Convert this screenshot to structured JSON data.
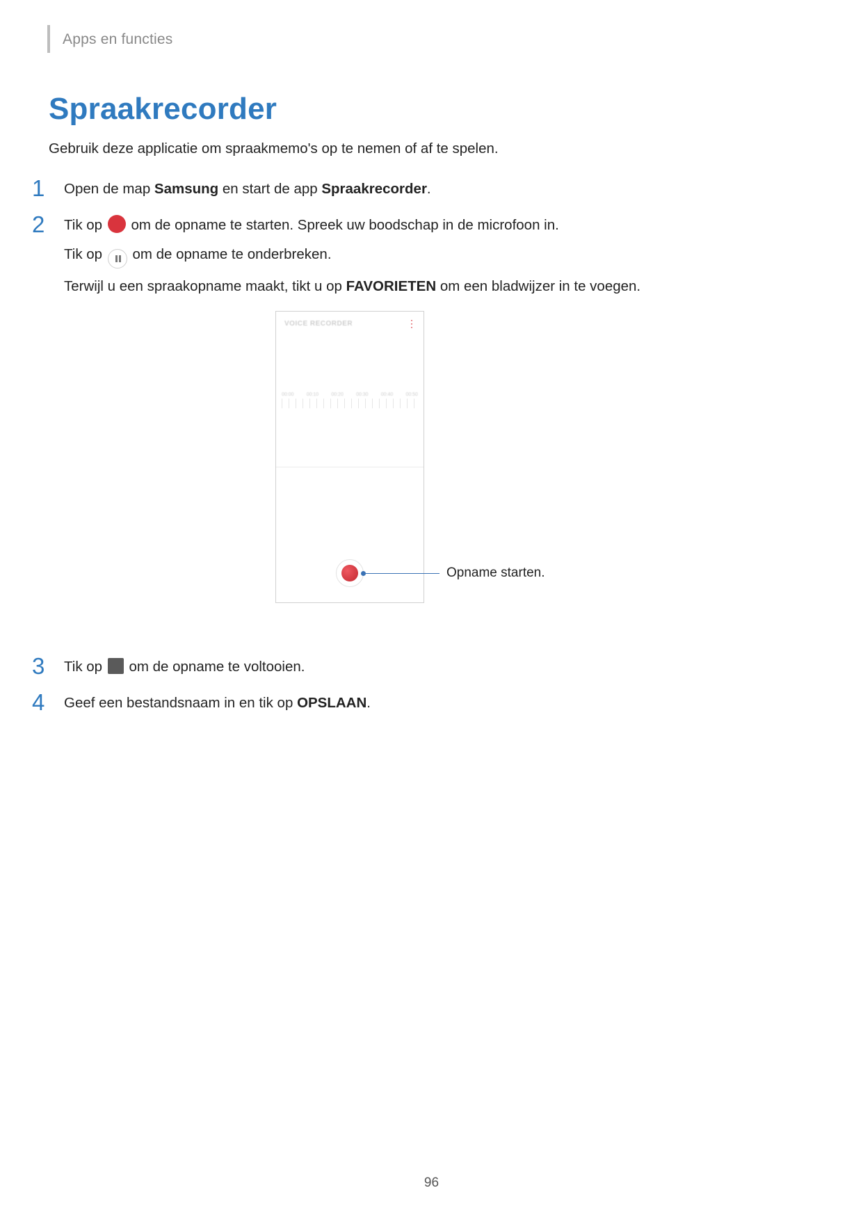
{
  "header": {
    "breadcrumb": "Apps en functies"
  },
  "title": "Spraakrecorder",
  "intro": "Gebruik deze applicatie om spraakmemo's op te nemen of af te spelen.",
  "steps": {
    "num1": "1",
    "s1_a": "Open de map ",
    "s1_b": "Samsung",
    "s1_c": " en start de app ",
    "s1_d": "Spraakrecorder",
    "s1_e": ".",
    "num2": "2",
    "s2a_a": "Tik op ",
    "s2a_b": " om de opname te starten. Spreek uw boodschap in de microfoon in.",
    "s2b_a": "Tik op ",
    "s2b_b": " om de opname te onderbreken.",
    "s2c_a": "Terwijl u een spraakopname maakt, tikt u op ",
    "s2c_b": "FAVORIETEN",
    "s2c_c": " om een bladwijzer in te voegen.",
    "num3": "3",
    "s3_a": "Tik op ",
    "s3_b": " om de opname te voltooien.",
    "num4": "4",
    "s4_a": "Geef een bestandsnaam in en tik op ",
    "s4_b": "OPSLAAN",
    "s4_c": "."
  },
  "figure": {
    "phone_title": "VOICE RECORDER",
    "ticks": [
      "00:00",
      "00:10",
      "00:20",
      "00:30",
      "00:40",
      "00:50"
    ],
    "callout": "Opname starten."
  },
  "page_number": "96"
}
